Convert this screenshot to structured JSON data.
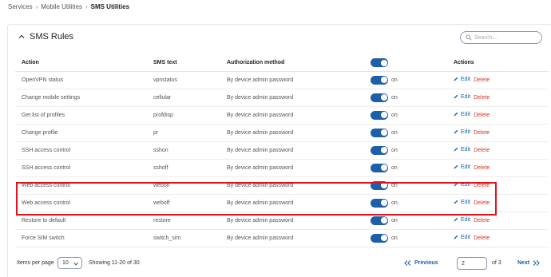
{
  "breadcrumb": {
    "items": [
      "Services",
      "Mobile Utilities",
      "SMS Utilities"
    ]
  },
  "section": {
    "title": "SMS Rules"
  },
  "search": {
    "placeholder": "Search..."
  },
  "table": {
    "headers": {
      "action": "Action",
      "sms_text": "SMS text",
      "auth": "Authorization method",
      "actions": "Actions"
    },
    "rows": [
      {
        "action": "OpenVPN status",
        "sms_text": "vpnstatus",
        "auth": "By device admin password",
        "enabled": "on"
      },
      {
        "action": "Change mobile settings",
        "sms_text": "cellular",
        "auth": "By device admin password",
        "enabled": "on"
      },
      {
        "action": "Get list of profiles",
        "sms_text": "profdisp",
        "auth": "By device admin password",
        "enabled": "on"
      },
      {
        "action": "Change profile",
        "sms_text": "pr",
        "auth": "By device admin password",
        "enabled": "on"
      },
      {
        "action": "SSH access control",
        "sms_text": "sshon",
        "auth": "By device admin password",
        "enabled": "on"
      },
      {
        "action": "SSH access control",
        "sms_text": "sshoff",
        "auth": "By device admin password",
        "enabled": "on"
      },
      {
        "action": "Web access control",
        "sms_text": "webon",
        "auth": "By device admin password",
        "enabled": "on"
      },
      {
        "action": "Web access control",
        "sms_text": "weboff",
        "auth": "By device admin password",
        "enabled": "on"
      },
      {
        "action": "Restore to default",
        "sms_text": "restore",
        "auth": "By device admin password",
        "enabled": "on"
      },
      {
        "action": "Force SIM switch",
        "sms_text": "switch_sim",
        "auth": "By device admin password",
        "enabled": "on"
      }
    ],
    "edit_label": "Edit",
    "delete_label": "Delete"
  },
  "pagination": {
    "items_per_page_label": "Items per page",
    "items_per_page_value": "10",
    "showing": "Showing 11-20 of 30",
    "previous_label": "Previous",
    "current_page": "2",
    "of_pages": "of 3",
    "next_label": "Next"
  },
  "colors": {
    "accent": "#1d5fa8",
    "delete": "#d9342b",
    "highlight": "#e0141e"
  }
}
